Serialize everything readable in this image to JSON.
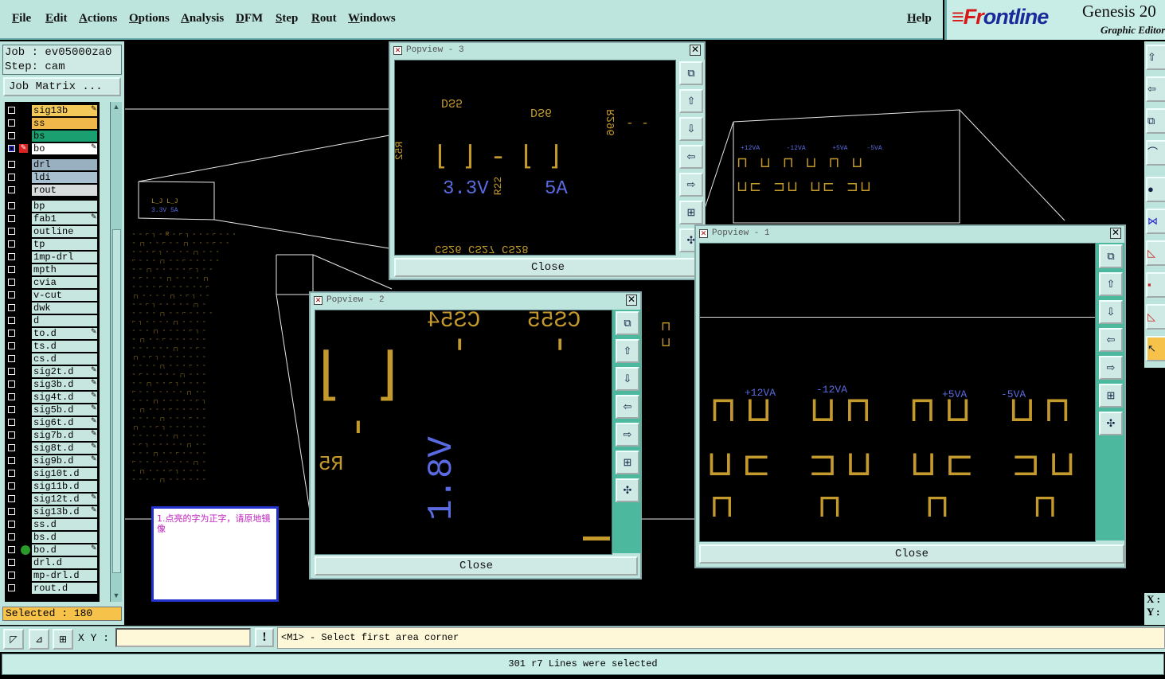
{
  "menu": [
    "File",
    "Edit",
    "Actions",
    "Options",
    "Analysis",
    "DFM",
    "Step",
    "Rout",
    "Windows"
  ],
  "help": "Help",
  "logo": {
    "brand_a": "≡Fr",
    "brand_b": "ontline",
    "product": "Genesis 20",
    "subtitle": "Graphic Editor"
  },
  "job": {
    "job_line": "Job : ev05000za0",
    "step_line": "Step: cam",
    "matrix_button": "Job Matrix ..."
  },
  "layers": [
    {
      "name": "sig13b",
      "color": "#f3c95a",
      "edit": true
    },
    {
      "name": "ss",
      "color": "#f0b84a",
      "edit": false
    },
    {
      "name": "bs",
      "color": "#1aa070",
      "edit": false
    },
    {
      "name": "bo",
      "color": "#ffffff",
      "edit": true,
      "work": true
    },
    {
      "name": "drl",
      "color": "#98b0c0",
      "edit": false
    },
    {
      "name": "ldi",
      "color": "#a8c0d0",
      "edit": false
    },
    {
      "name": "rout",
      "color": "#d8dcdc",
      "edit": false
    },
    {
      "name": "bp",
      "color": "#c7e6e0",
      "edit": false
    },
    {
      "name": "fab1",
      "color": "#c7e6e0",
      "edit": true
    },
    {
      "name": "outline",
      "color": "#c7e6e0",
      "edit": false
    },
    {
      "name": "tp",
      "color": "#c7e6e0",
      "edit": false
    },
    {
      "name": "1mp-drl",
      "color": "#c7e6e0",
      "edit": false
    },
    {
      "name": "mpth",
      "color": "#c7e6e0",
      "edit": false
    },
    {
      "name": "cvia",
      "color": "#c7e6e0",
      "edit": false
    },
    {
      "name": "v-cut",
      "color": "#c7e6e0",
      "edit": false
    },
    {
      "name": "dwk",
      "color": "#c7e6e0",
      "edit": false
    },
    {
      "name": "d",
      "color": "#c7e6e0",
      "edit": false
    },
    {
      "name": "to.d",
      "color": "#c7e6e0",
      "edit": true
    },
    {
      "name": "ts.d",
      "color": "#c7e6e0",
      "edit": false
    },
    {
      "name": "cs.d",
      "color": "#c7e6e0",
      "edit": false
    },
    {
      "name": "sig2t.d",
      "color": "#c7e6e0",
      "edit": true
    },
    {
      "name": "sig3b.d",
      "color": "#c7e6e0",
      "edit": true
    },
    {
      "name": "sig4t.d",
      "color": "#c7e6e0",
      "edit": true
    },
    {
      "name": "sig5b.d",
      "color": "#c7e6e0",
      "edit": true
    },
    {
      "name": "sig6t.d",
      "color": "#c7e6e0",
      "edit": true
    },
    {
      "name": "sig7b.d",
      "color": "#c7e6e0",
      "edit": true
    },
    {
      "name": "sig8t.d",
      "color": "#c7e6e0",
      "edit": true
    },
    {
      "name": "sig9b.d",
      "color": "#c7e6e0",
      "edit": true
    },
    {
      "name": "sig10t.d",
      "color": "#c7e6e0",
      "edit": false
    },
    {
      "name": "sig11b.d",
      "color": "#c7e6e0",
      "edit": false
    },
    {
      "name": "sig12t.d",
      "color": "#c7e6e0",
      "edit": true
    },
    {
      "name": "sig13b.d",
      "color": "#c7e6e0",
      "edit": true
    },
    {
      "name": "ss.d",
      "color": "#c7e6e0",
      "edit": false
    },
    {
      "name": "bs.d",
      "color": "#c7e6e0",
      "edit": false
    },
    {
      "name": "bo.d",
      "color": "#c7e6e0",
      "edit": true,
      "dot": true
    },
    {
      "name": "drl.d",
      "color": "#c7e6e0",
      "edit": false
    },
    {
      "name": "mp-drl.d",
      "color": "#c7e6e0",
      "edit": false
    },
    {
      "name": "rout.d",
      "color": "#c7e6e0",
      "edit": false
    }
  ],
  "selected": "Selected : 180",
  "popview3": {
    "title": "Popview - 3",
    "close": "Close",
    "labels": {
      "ds5": "DS5",
      "ds6": "DS6",
      "r296": "R296",
      "r52": "R52",
      "r22": "R22",
      "v33": "3.3V",
      "a5": "5A",
      "caps": "CS26  CS27  CS28"
    }
  },
  "popview2": {
    "title": "Popview - 2",
    "close": "Close",
    "labels": {
      "cs54": "CS54",
      "cs55": "CS55",
      "r5": "R5",
      "v18": "1.8V"
    }
  },
  "popview1": {
    "title": "Popview - 1",
    "close": "Close",
    "labels": {
      "p12": "+12VA",
      "m12": "-12VA",
      "p5": "+5VA",
      "m5": "-5VA"
    }
  },
  "note": "1.点亮的字为正字，请原地镜像",
  "xy_label": "X Y :",
  "xy_value": "",
  "prompt": "<M1> - Select first area corner",
  "status": "301 r7 Lines were selected",
  "coords": {
    "x": "X :",
    "y": "Y :"
  }
}
